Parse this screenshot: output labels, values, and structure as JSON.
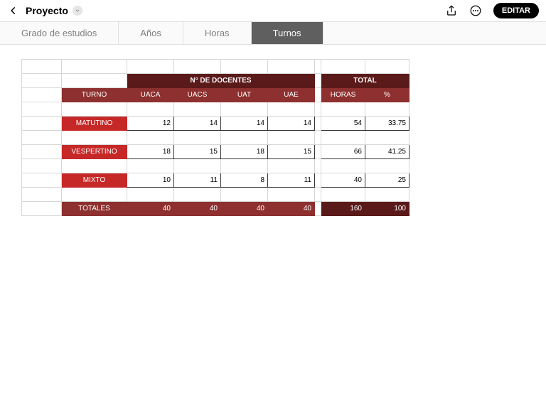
{
  "header": {
    "title": "Proyecto",
    "editLabel": "EDITAR"
  },
  "tabs": {
    "items": [
      "Grado de estudios",
      "Años",
      "Horas",
      "Turnos"
    ],
    "activeIndex": 3
  },
  "table": {
    "groupHeader1": "N° DE DOCENTES",
    "groupHeader2": "TOTAL",
    "rowHeaderLabel": "TURNO",
    "colHeaders": [
      "UACA",
      "UACS",
      "UAT",
      "UAE"
    ],
    "totalCols": [
      "HORAS",
      "%"
    ],
    "rows": [
      {
        "label": "MATUTINO",
        "vals": [
          "12",
          "14",
          "14",
          "14"
        ],
        "horas": "54",
        "pct": "33.75"
      },
      {
        "label": "VESPERTINO",
        "vals": [
          "18",
          "15",
          "18",
          "15"
        ],
        "horas": "66",
        "pct": "41.25"
      },
      {
        "label": "MIXTO",
        "vals": [
          "10",
          "11",
          "8",
          "11"
        ],
        "horas": "40",
        "pct": "25"
      }
    ],
    "totalsLabel": "TOTALES",
    "totals": {
      "vals": [
        "40",
        "40",
        "40",
        "40"
      ],
      "horas": "160",
      "pct": "100"
    }
  },
  "chart_data": {
    "type": "table",
    "title": "N° DE DOCENTES / TOTAL por TURNO",
    "columns": [
      "TURNO",
      "UACA",
      "UACS",
      "UAT",
      "UAE",
      "HORAS",
      "%"
    ],
    "rows": [
      [
        "MATUTINO",
        12,
        14,
        14,
        14,
        54,
        33.75
      ],
      [
        "VESPERTINO",
        18,
        15,
        18,
        15,
        66,
        41.25
      ],
      [
        "MIXTO",
        10,
        11,
        8,
        11,
        40,
        25
      ],
      [
        "TOTALES",
        40,
        40,
        40,
        40,
        160,
        100
      ]
    ]
  }
}
